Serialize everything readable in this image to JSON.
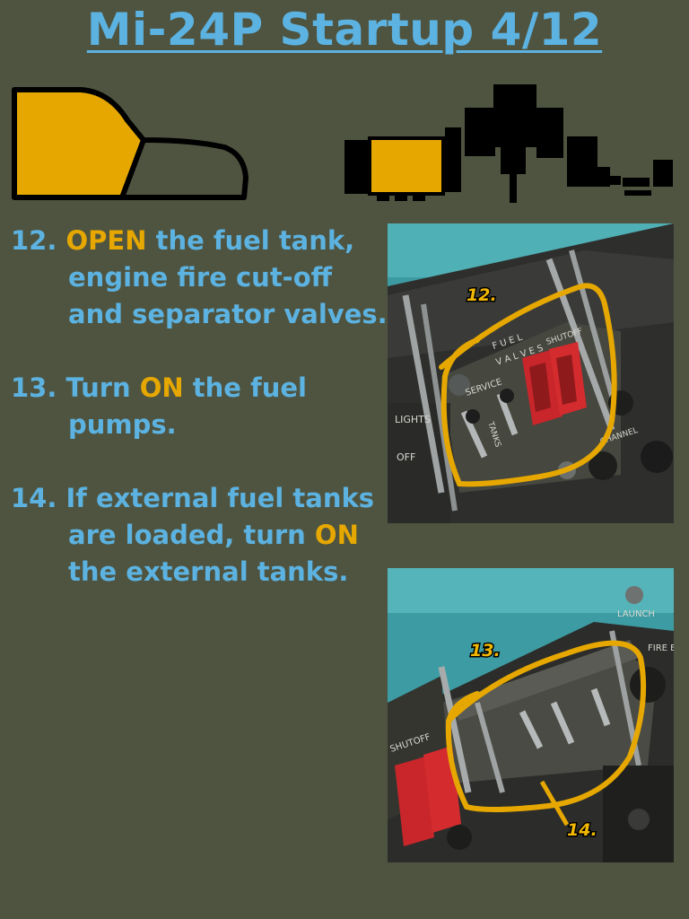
{
  "title": "Mi-24P Startup 4/12",
  "colors": {
    "background": "#4f5440",
    "text_blue": "#5cb2e0",
    "highlight": "#e6a800"
  },
  "steps": [
    {
      "num": "12.",
      "pre": " ",
      "key": "OPEN",
      "post": " the fuel tank, engine fire cut-off and separator valves."
    },
    {
      "num": "13.",
      "pre": " Turn ",
      "key": "ON",
      "post": " the fuel pumps."
    },
    {
      "num": "14.",
      "pre": " If external fuel tanks are loaded, turn ",
      "key": "ON",
      "post": " the external tanks."
    }
  ],
  "photos": {
    "top": {
      "callout": "12."
    },
    "bottom": {
      "callout_a": "13.",
      "callout_b": "14."
    },
    "panel_labels": {
      "lights": "LIGHTS",
      "fuel": "F U E L",
      "valves": "V A L V E S",
      "shutoff": "SHUTOFF",
      "service": "SERVICE",
      "tanks": "TANKS",
      "off": "OFF",
      "channel": "CHANNEL",
      "launch": "LAUNCH",
      "fire_ext": "FIRE EX"
    }
  }
}
